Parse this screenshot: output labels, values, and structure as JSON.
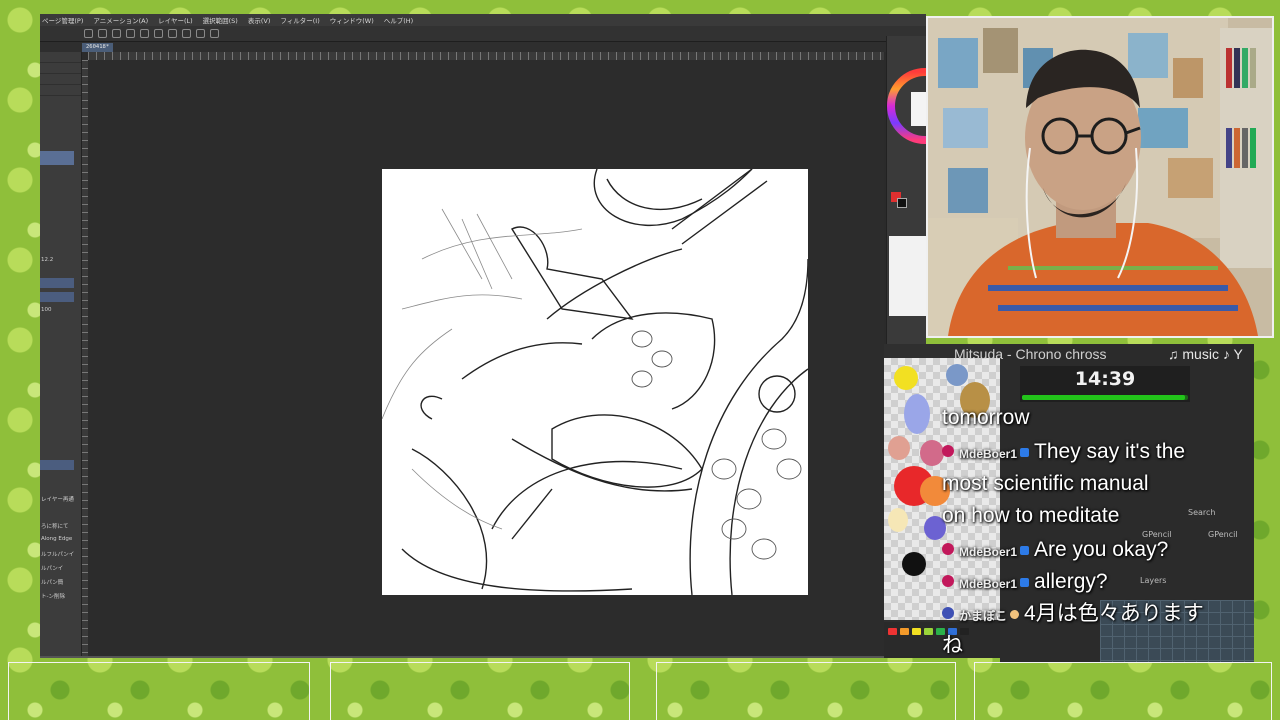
{
  "app": {
    "menu": [
      "ページ管理(P)",
      "アニメーション(A)",
      "レイヤー(L)",
      "選択範囲(S)",
      "表示(V)",
      "フィルター(I)",
      "ウィンドウ(W)",
      "ヘルプ(H)"
    ],
    "tab_label": "260418*",
    "left_panel": {
      "labels": [
        "レイヤー再通",
        "ろに称にて",
        "Along Edge",
        "ルフルパンイ",
        "ルパンイ",
        "ルパン簡",
        "ト-ン削除"
      ],
      "value1": "100",
      "value2": "12.2"
    }
  },
  "song": {
    "artist": "Mitsuda - Chrono chross",
    "label": "♫ music ♪ Y"
  },
  "timer": {
    "value": "14:39",
    "progress": 0.98
  },
  "chat": {
    "messages": [
      {
        "user": "",
        "text": "tomorrow"
      },
      {
        "user": "MdeBoer1",
        "text": "They say it's the"
      },
      {
        "user": "",
        "text": "most scientific manual"
      },
      {
        "user": "",
        "text": "on how to meditate"
      },
      {
        "user": "MdeBoer1",
        "text": "Are you okay?"
      },
      {
        "user": "MdeBoer1",
        "text": "allergy?"
      },
      {
        "user": "かまぼこ",
        "text": "4月は色々あります"
      },
      {
        "user": "",
        "text": "ね"
      }
    ]
  },
  "blender": {
    "search": "Search",
    "item1": "GPencil",
    "item2": "GPencil",
    "layers": "Layers"
  },
  "colors": {
    "accent_green": "#22c31a",
    "badge_pink": "#c2185b"
  }
}
